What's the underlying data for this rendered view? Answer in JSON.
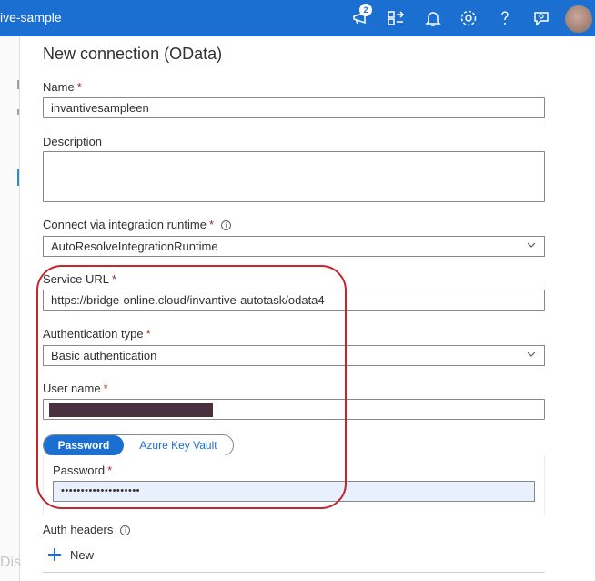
{
  "topbar": {
    "title": "ive-sample",
    "notification_count": "2",
    "icons": [
      "notifications-icon",
      "directory-icon",
      "bell-icon",
      "settings-icon",
      "help-icon",
      "feedback-icon"
    ]
  },
  "left": {
    "faded_text": "Disc"
  },
  "panel": {
    "title": "New connection (OData)",
    "name": {
      "label": "Name",
      "required": "*",
      "value": "invantivesampleen"
    },
    "description": {
      "label": "Description",
      "value": ""
    },
    "runtime": {
      "label": "Connect via integration runtime",
      "required": "*",
      "value": "AutoResolveIntegrationRuntime"
    },
    "service_url": {
      "label": "Service URL",
      "required": "*",
      "value": "https://bridge-online.cloud/invantive-autotask/odata4"
    },
    "auth_type": {
      "label": "Authentication type",
      "required": "*",
      "value": "Basic authentication"
    },
    "user_name": {
      "label": "User name",
      "required": "*"
    },
    "password_toggle": {
      "option_a": "Password",
      "option_b": "Azure Key Vault",
      "selected": "Password"
    },
    "password": {
      "label": "Password",
      "required": "*",
      "value": "••••••••••••••••••••"
    },
    "auth_headers": {
      "label": "Auth headers",
      "new_label": "New"
    }
  },
  "colors": {
    "accent": "#1a6fd1",
    "required": "#a4262c",
    "annotation": "#c1272d"
  }
}
